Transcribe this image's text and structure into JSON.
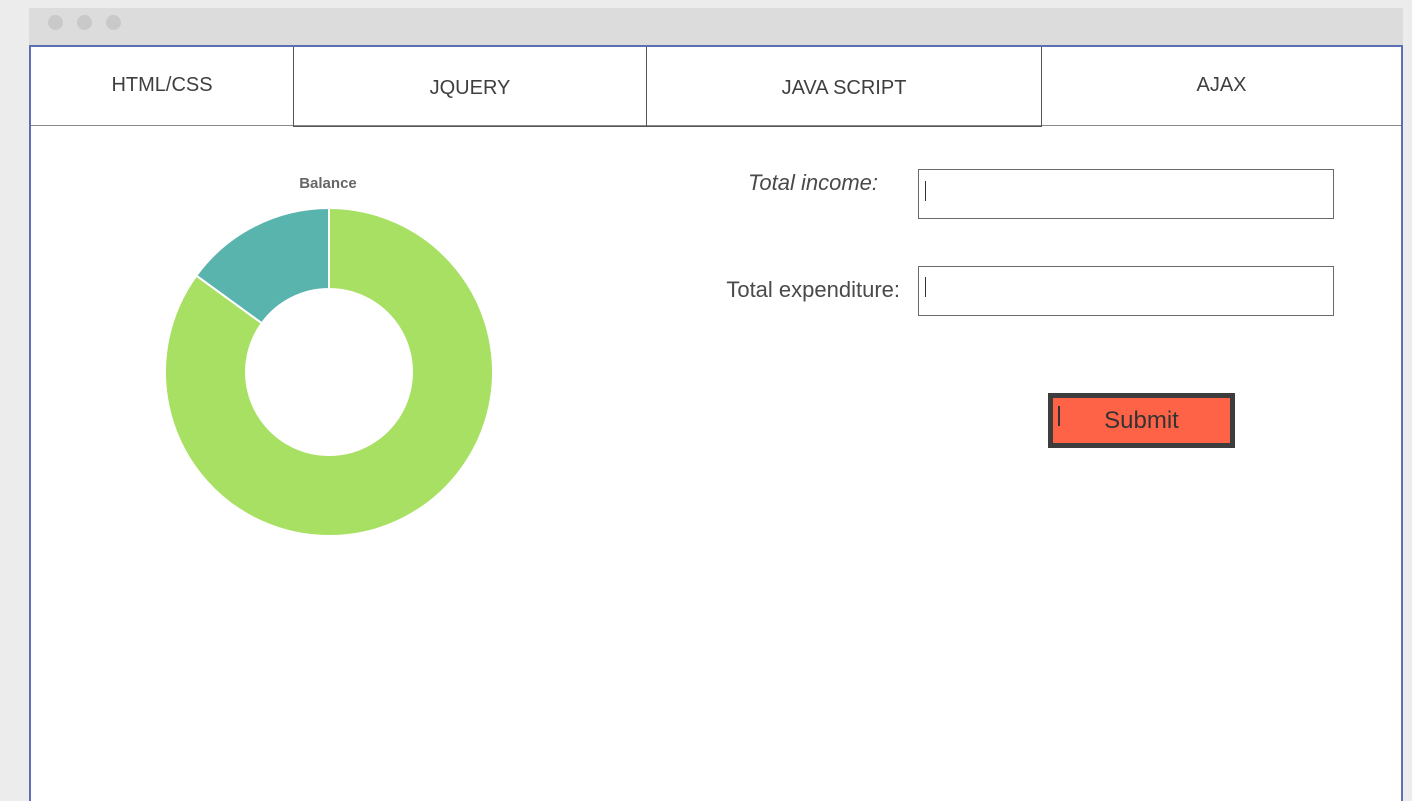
{
  "window": {
    "controls": [
      "close",
      "minimize",
      "maximize"
    ]
  },
  "tabs": [
    {
      "label": "HTML/CSS"
    },
    {
      "label": "JQUERY"
    },
    {
      "label": "JAVA SCRIPT"
    },
    {
      "label": "AJAX"
    }
  ],
  "form": {
    "income_label": "Total income:",
    "income_value": "",
    "expenditure_label": "Total expenditure:",
    "expenditure_value": "",
    "submit_label": "Submit"
  },
  "colors": {
    "accent_submit": "#ff6347",
    "chart_green": "#a8e063",
    "chart_teal": "#5ab4ae"
  },
  "chart_data": {
    "type": "pie",
    "title": "Balance",
    "donut": true,
    "legend": "none",
    "slices": [
      {
        "color": "#a8e063",
        "value": 85
      },
      {
        "color": "#5ab4ae",
        "value": 15
      }
    ]
  }
}
